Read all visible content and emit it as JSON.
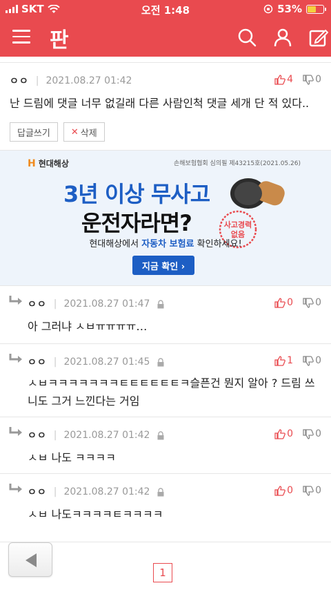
{
  "status": {
    "carrier": "SKT",
    "time": "오전 1:48",
    "battery": "53%"
  },
  "app": {
    "logo": "판",
    "accent": "#e94a4f"
  },
  "comments": [
    {
      "author": "ㅇㅇ",
      "date": "2021.08.27 01:42",
      "up": "4",
      "down": "0",
      "text": "난 드림에 댓글 너무 없길래 다른 사람인척 댓글 세개 단 적 있다..",
      "reply_btn": "답글쓰기",
      "delete_btn": "삭제"
    },
    {
      "author": "ㅇㅇ",
      "date": "2021.08.27 01:47",
      "up": "0",
      "down": "0",
      "text": "아 그러냐 ㅅㅂㅠㅠㅠㅠ…"
    },
    {
      "author": "ㅇㅇ",
      "date": "2021.08.27 01:45",
      "up": "1",
      "down": "0",
      "text": "ㅅㅂㅋㅋㅋㅋㅋㅋㅋㅌㅌㅌㅌㅌㅌㅋ슬픈건 뭔지 알아 ? 드림 쓰니도 그거 느낀다는 거임"
    },
    {
      "author": "ㅇㅇ",
      "date": "2021.08.27 01:42",
      "up": "0",
      "down": "0",
      "text": "ㅅㅂ 나도 ㅋㅋㅋㅋ"
    },
    {
      "author": "ㅇㅇ",
      "date": "2021.08.27 01:42",
      "up": "0",
      "down": "0",
      "text": "ㅅㅂ 나도ㅋㅋㅋㅋㅌㅋㅋㅋㅋ"
    }
  ],
  "ad": {
    "brand": "현대해상",
    "notice": "손해보험협회 심의필 제43215호(2021.05.26)",
    "headline1": "3년 이상 무사고",
    "headline2": "운전자라면?",
    "stamp": "사고경력 없음",
    "sub_pre": "현대해상에서 ",
    "sub_highlight": "자동차 보험료",
    "sub_post": " 확인하세요!",
    "cta": "지금 확인 ›"
  },
  "pager": {
    "current": "1"
  }
}
